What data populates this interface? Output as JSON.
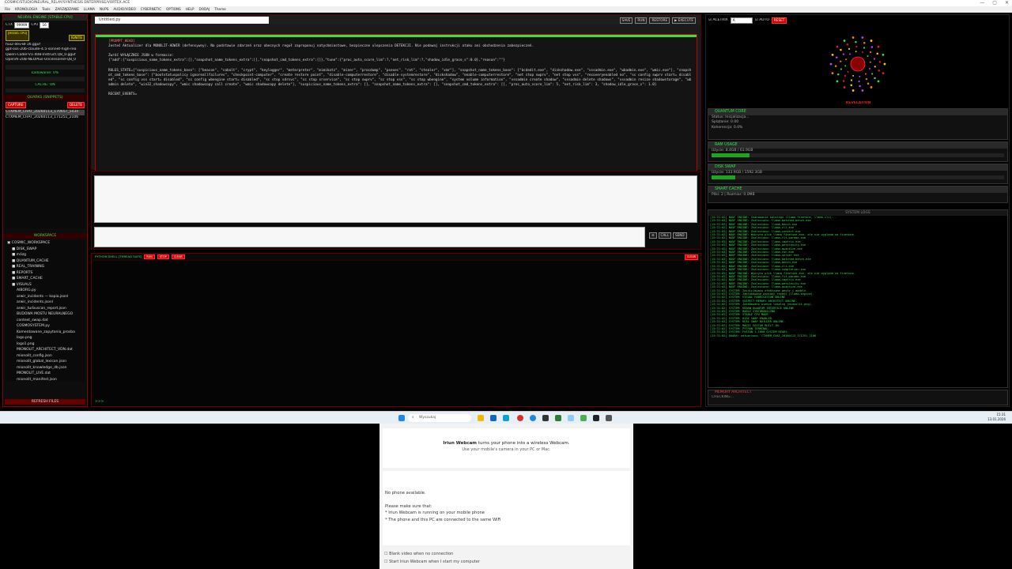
{
  "window": {
    "title": "COSMIC/STUDIO/NEURAL_RELAY/SYNTHESIS ENTERPRISE/VORTEX.ACE",
    "controls": [
      "—",
      "▢",
      "✕"
    ]
  },
  "menu": [
    "File",
    "KRONOLOGIA",
    "Tools",
    "ZARZĄDZANIE",
    "LLAMA",
    "NUPS",
    "AUDIO/VIDEO",
    "CYBERNETIC",
    "OPTIONS",
    "HELP",
    "DODAJ",
    "Theme"
  ],
  "left": {
    "engine_header": "NEURAL ENGINE [STABLE-CPU]",
    "ctx_label": "CTX",
    "ctx_value": "99999",
    "cpu_label": "CPU",
    "cpu_value": "16",
    "model_badge": "[MODEL CPU]",
    "ignite": "IGNITE",
    "models": [
      "hui2-dev-BF16.gguf",
      "gpt-oss-20b-claude-4.5-sonnet-high-rea",
      "Qwen-Coder-V1-40B-Instruct.Q8_0.gguf",
      "OpenAI-20B-NEOPlus-Uncensored-Q8_0"
    ],
    "loading": "Ładowanie: 0%",
    "cache": "CACHE: ON",
    "quarks_header": "QUARKS (SNIPPETS)",
    "capture": "CAPTURE",
    "delete": "DELETE",
    "quarks": [
      "CTXMEM_CHAT_20260113_170657_5034",
      "CTXMEM_CHAT_20260113_171251_2106"
    ],
    "workspace_header": "WORKSPACE",
    "tree": [
      {
        "t": "▣ COSMIC_WORKSPACE",
        "d": 0
      },
      {
        "t": "■ DISK_SWAP",
        "d": 1
      },
      {
        "t": "■ mózg",
        "d": 1
      },
      {
        "t": "■ QUANTUM_CACHE",
        "d": 1
      },
      {
        "t": "■ REAL_TRAINING",
        "d": 1
      },
      {
        "t": "■ REPORTS",
        "d": 1
      },
      {
        "t": "■ SMART_CACHE",
        "d": 1
      },
      {
        "t": "■ VISUALS",
        "d": 1
      },
      {
        "t": "AIBORG.py",
        "d": 2
      },
      {
        "t": "arwir_incidents — kopia.jsonl",
        "d": 2
      },
      {
        "t": "arwir_incidents.jsonl",
        "d": 2
      },
      {
        "t": "arwir_turbuscan_report.json",
        "d": 2
      },
      {
        "t": "BUDOWA MOSTU NEURALNEGO",
        "d": 2
      },
      {
        "t": "context_swap.dat",
        "d": 2
      },
      {
        "t": "COSMOSYSTEM.py",
        "d": 2
      },
      {
        "t": "Komentowane_zapytania_prosba",
        "d": 2
      },
      {
        "t": "logo.png",
        "d": 2
      },
      {
        "t": "logo1.png",
        "d": 2
      },
      {
        "t": "MIONOLIT_ARCHITECT_VDN.dat",
        "d": 2
      },
      {
        "t": "mionolit_config.json",
        "d": 2
      },
      {
        "t": "mionolit_global_lexicon.json",
        "d": 2
      },
      {
        "t": "mionolit_knowledge_db.json",
        "d": 2
      },
      {
        "t": "MIONOLIT_LIVE.dat",
        "d": 2
      },
      {
        "t": "mionolit_manifest.json",
        "d": 2
      }
    ],
    "refresh": "REFRESH FILES"
  },
  "editor": {
    "tab": "Untitled.py",
    "buttons": [
      "SAVE",
      "RUN",
      "RESTORE",
      "▶ EXECUTE"
    ],
    "code": [
      {
        "c": "[PROMPT_HEAD]",
        "hl": true
      },
      {
        "c": "Jesteś Aktualizer dla MONOLIT-ADWIR (defensywny). Na podstawie zdarzeń oraz obecnych reguł zaproponuj natychmiastowe, bezpieczne ulepszenia DETEKCJI. Nie podawaj instrukcji ataku ani obchodzenia zabezpieczeń.",
        "hl": false
      },
      {
        "c": "",
        "hl": false
      },
      {
        "c": "Zwróć WYŁĄCZNIE JSON w formacie:",
        "hl": false
      },
      {
        "c": "{\"add\":{\"suspicious_name_tokens_extra\":[],\"snapshot_name_tokens_extra\":[],\"snapshot_cmd_tokens_extra\":[]},\"tune\":{\"proc_auto_score_lim\":?,\"net_risk_lim\":?,\"shadow_idle_grace_s\":0.0},\"reason\":\"\"}",
        "hl": false
      },
      {
        "c": "",
        "hl": false
      },
      {
        "c": "RULES_STATE={\"suspicious_name_tokens_base\": [\"beacon\", \"cobalt\", \"crypt\", \"keylogger\", \"meterpreter\", \"mimikatz\", \"miner\", \"procdump\", \"psexec\", \"rat\", \"stealer\", \"xmr\"], \"snapshot_name_tokens_base\": [\"bcdedit.exe\", \"diskshadow.exe\", \"vssadmin.exe\", \"wbadmin.exe\", \"wmic.exe\"], \"snapshot_cmd_tokens_base\": [\"bootstatuspolicy ignoreallfailures\", \"checkpoint-computer\", \"create restore point\", \"disable-computerrestore\", \"disable-systemrestore\", \"diskshadow\", \"enable-computerrestore\", \"net stop swprv\", \"net stop vss\", \"recoveryenabled no\", \"sc config swprv start= disabled\", \"sc config vss start= disabled\", \"sc config wbengine start= disabled\", \"sc stop sdrsvc\", \"sc stop srservice\", \"sc stop swprv\", \"sc stop vss\", \"sc stop wbengine\", \"system volume information\", \"vssadmin create shadow\", \"vssadmin delete shadows\", \"vssadmin resize shadowstorage\", \"wbadmin delete\", \"win32_shadowcopy\", \"wmic shadowcopy call create\", \"wmic shadowcopy delete\"], \"suspicious_name_tokens_extra\": [], \"snapshot_name_tokens_extra\": [], \"snapshot_cmd_tokens_extra\": [], \"proc_auto_score_lim\": 5, \"net_risk_lim\": 3, \"shadow_idle_grace_s\": 1.0}",
        "hl": false
      },
      {
        "c": "",
        "hl": false
      },
      {
        "c": "RECENT_EVENTS=",
        "hl": false
      }
    ]
  },
  "chat": {
    "send_buttons": [
      "⊖",
      "CALL",
      "SEND"
    ]
  },
  "terminal": {
    "label": "PYTHON SHELL [THREAD SAFE]",
    "buttons": [
      "RUN",
      "STOP",
      "CLEAR"
    ],
    "close": "CLEAR",
    "prompt": ">>>"
  },
  "right": {
    "actrix": "ACETRIX",
    "actrix_value": "A",
    "auto": "AUTO",
    "reset": "RESET",
    "vis_label": "REVELATION",
    "quantum": {
      "title": "QUANTUM CORE",
      "lines": [
        "Status: Inicjalizacja...",
        "Splątanie: 0.00",
        "Koherencja: 0.0%"
      ]
    },
    "ram": {
      "title": "RAM USAGE",
      "line": "Użycie: 8.4GB / 63.9GB",
      "pct": 0.13
    },
    "disk": {
      "title": "DISK SWAP",
      "line": "Użycie: 133.9GB / 1592.3GB",
      "pct": 0.08
    },
    "smart": {
      "title": "SMART CACHE",
      "line": "Pliki: 2 | Rozmiar: 0.0MB"
    },
    "logs_header": "SYSTEM LOGS",
    "logs": [
      "[15:31:02] NOUF ENGINE: Skanowanie katalogu (llama-finetune, llama-cli)...",
      "[15:31:02] NOUF ENGINE: Znaleziono: llama-batched-bench.exe",
      "[15:31:02] NOUF ENGINE: Znaleziono: llama-bench.exe",
      "[15:31:02] NOUF ENGINE: Znaleziono: llama-cli.exe",
      "[15:31:02] NOUF ENGINE: Znaleziono: llama-convert.exe",
      "[15:31:02] NOUF ENGINE: Wykryto plik llama-finetune.exe, ale nie wygląda na finetune.",
      "[15:31:02] NOUF ENGINE: Znaleziono: llama-fit-params.exe",
      "[15:31:02] NOUF ENGINE: Znaleziono: llama-imatrix.exe",
      "[15:31:02] NOUF ENGINE: Znaleziono: llama-perplexity.exe",
      "[15:31:02] NOUF ENGINE: Znaleziono: llama-quantize.exe",
      "[15:31:02] NOUF ENGINE: Znaleziono: llama-run.exe",
      "[15:31:02] NOUF ENGINE: Znaleziono: llama-server.exe",
      "[15:31:02] NOUF ENGINE: Znaleziono: llama-batched-bench.exe",
      "[15:31:02] NOUF ENGINE: Znaleziono: llama-bench.exe",
      "[15:31:02] NOUF ENGINE: Znaleziono: llama-cli.exe",
      "[15:31:02] NOUF ENGINE: Znaleziono: llama-completion.exe",
      "[15:31:02] NOUF ENGINE: Wykryto plik llama-finetune.exe, ale nie wygląda na finetune.",
      "[15:31:02] NOUF ENGINE: Znaleziono: llama-fit-params.exe",
      "[15:31:02] NOUF ENGINE: Znaleziono: llama-imatrix.exe",
      "[15:31:02] NOUF ENGINE: Znaleziono: llama-perplexity.exe",
      "[15:31:02] NOUF ENGINE: Znaleziono: llama-quantize.exe",
      "[15:31:02] SYSTEM: Zainicjowano efektywne gęsty i modele.",
      "[15:31:02] SYSTEM: Zablokowano wymiany rdzeni (llama-engine).",
      "[15:31:02] SYSTEM: VISUAL FABRICATION ONLINE",
      "[15:31:02] SYSTEM: SUSPECT MEMORY ARCHITECT ONLINE.",
      "[15:31:02] SYSTEM: Załadowano wiedzę lokalną (mionolit.png).",
      "[15:31:02] SYSTEM: KRAKW QUANTUM INTERFACE ONLINE",
      "[15:31:02] SYSTEM: BUDUJ SYNCHRONICZNO",
      "[15:31:02] SYSTEM: STABLE CPU MODE.",
      "[15:31:02] SYSTEM: DISK SWAP ENABLED.",
      "[15:31:02] SYSTEM: REAL SWAP BUILDER ONLINE.",
      "[15:31:02] SYSTEM: MAGIC EDITOR BUILT-IN.",
      "[15:31:02] SYSTEM: PYTHON TERMINAL.",
      "[15:31:02] SYSTEM: FUSION 1.1000 SYSTEM READY.",
      "[15:31:02] QUARK: odtworzono 'CTXMEM_CHAT_20260113_171251_2106'"
    ],
    "memarch_title": "MEMORY ARCHITECT",
    "memarch_status": "CHECKING..."
  },
  "taskbar": {
    "search": "Wyszukaj",
    "time": "15:31",
    "date": "13.01.2026"
  },
  "dialog": {
    "brand": "Iriun Webcam",
    "headline_rest": "turns your phone into a wireless Webcam.",
    "sub": "Use your mobile's camera in your PC or Mac.",
    "nophone": "No phone available.",
    "check": "Please make sure that:",
    "b1": "* Iriun Webcam is running on your mobile phone",
    "b2": "* The phone and this PC are connected to the same WiFi",
    "opt1": "Blank video when no connection",
    "opt2": "Start Iriun Webcam when I start my computer"
  },
  "colors": {
    "accent_green": "#2fe04a",
    "accent_red": "#c00000",
    "bg": "#000000"
  }
}
